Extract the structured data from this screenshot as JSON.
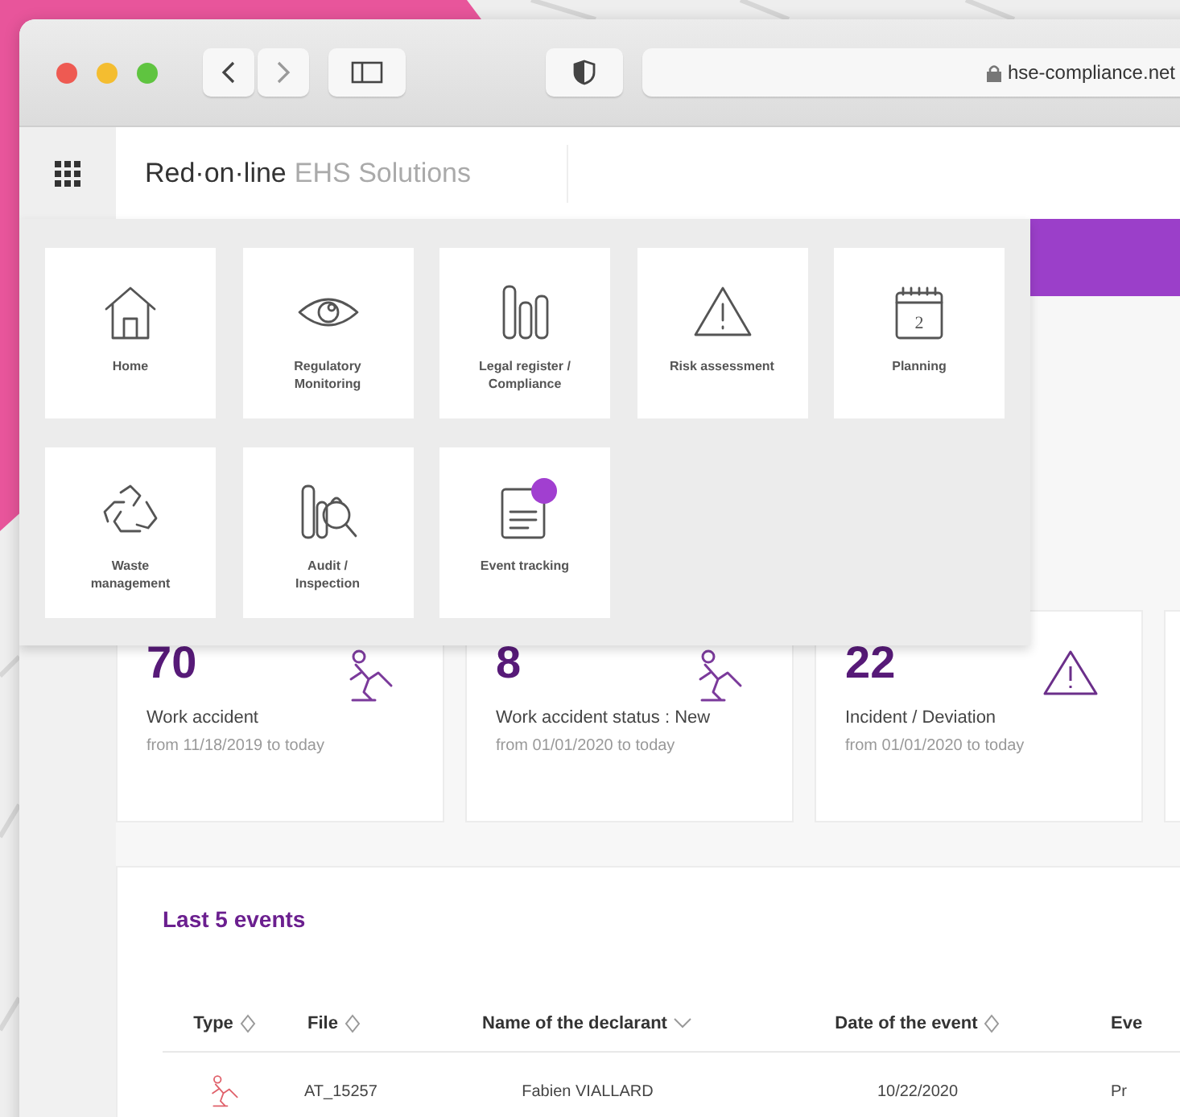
{
  "browser": {
    "address": "hse-compliance.net"
  },
  "header": {
    "brand": "Red·on·line",
    "product": "EHS Solutions"
  },
  "menu": {
    "items": [
      {
        "label": "Home",
        "kind": "home",
        "badge": false
      },
      {
        "label": "Regulatory Monitoring",
        "kind": "eye",
        "badge": false
      },
      {
        "label": "Legal register / Compliance",
        "kind": "bars",
        "badge": false
      },
      {
        "label": "Risk assessment",
        "kind": "warning",
        "badge": false
      },
      {
        "label": "Planning",
        "kind": "calendar",
        "badge": false,
        "day": "2"
      },
      {
        "label": "Waste management",
        "kind": "recycle",
        "badge": false
      },
      {
        "label": "Audit / Inspection",
        "kind": "audit",
        "badge": false
      },
      {
        "label": "Event tracking",
        "kind": "document",
        "badge": true
      }
    ]
  },
  "stats": [
    {
      "value": "70",
      "label": "Work accident",
      "period": "from 11/18/2019 to today",
      "kind": "fall"
    },
    {
      "value": "8",
      "label": "Work accident status : New",
      "period": "from 01/01/2020 to today",
      "kind": "fall"
    },
    {
      "value": "22",
      "label": "Incident / Deviation",
      "period": "from 01/01/2020 to today",
      "kind": "warning"
    }
  ],
  "events": {
    "title": "Last 5 events",
    "columns": [
      {
        "label": "Type",
        "sorted": false
      },
      {
        "label": "File",
        "sorted": false
      },
      {
        "label": "Name of the declarant",
        "sorted": true
      },
      {
        "label": "Date of the event",
        "sorted": false
      },
      {
        "label": "Eve"
      }
    ],
    "rows": [
      {
        "kind": "fall",
        "file": "AT_15257",
        "declarant": "Fabien VIALLARD",
        "date": "10/22/2020",
        "column_5": "Pr"
      }
    ]
  }
}
